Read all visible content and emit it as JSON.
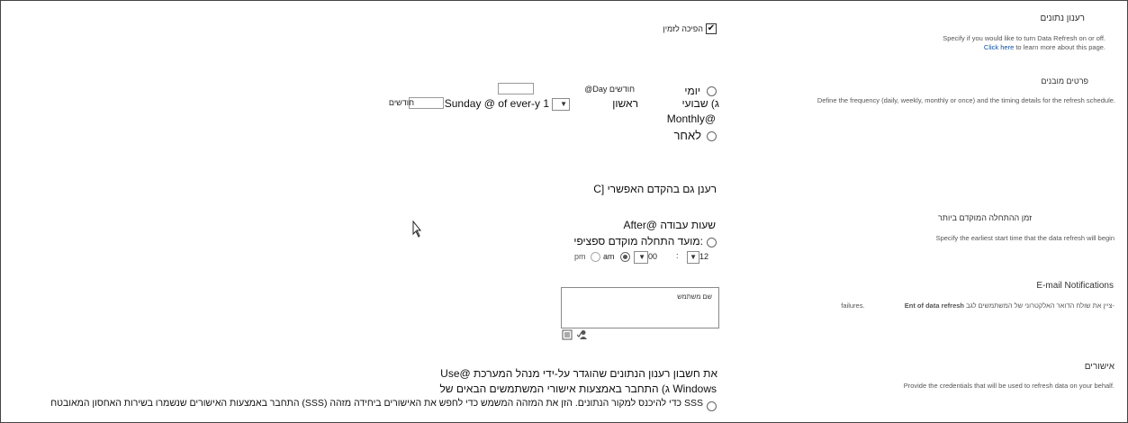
{
  "sections": {
    "refresh": {
      "title": "רענון נתונים",
      "desc_prefix": "Specify if you would like to turn Data Refresh on or off.",
      "link_text": "Click here",
      "desc_suffix": "to learn more about this page.",
      "toggle_label": "הפיכה לזמין",
      "checked": true
    },
    "schedule": {
      "title": "פרטים מובנים",
      "desc": "Define the frequency (daily, weekly, monthly or once) and the timing details for the refresh schedule.",
      "daily_label": "יומי",
      "daily_value": "@Day חודשים",
      "weekly_label": "ג) שבועי",
      "weekly_value": "ראשון",
      "monthly_label": "Monthly@",
      "monthly_value": "Sunday @ of ever-y 1",
      "monthly_suffix": "חודשים",
      "once_label": "לאחר",
      "also_refresh_label": "C] רענן גם בהקדם האפשרי"
    },
    "earliest": {
      "title": "זמן ההתחלה המוקדם ביותר",
      "desc": "Specify the earliest start time that the data refresh will begin",
      "after_label": "After@ שעות עבודה",
      "specific_label": "מועד התחלה מוקדם ספציפי:",
      "hour": "12",
      "separator": ":",
      "minute": "00",
      "am": "am",
      "pm": "pm",
      "am_selected": true
    },
    "email": {
      "title": "E-mail Notifications",
      "desc_prefix": "ציין את שולח הדואר האלקטרוני של המשתמשים לגב-",
      "desc_bold": "Ent of data refresh",
      "desc_suffix": "failures.",
      "field_value": "שם משתמש"
    },
    "credentials": {
      "title": "אישורים",
      "desc": "Provide the credentials that will be used to refresh data on your behalf.",
      "option1": "Use@ את חשבון רענון הנתונים שהוגדר על-ידי מנהל המערכת",
      "option2": "ג) התחבר באמצעות אישורי המשתמשים הבאים של Windows",
      "option3": "התחבר באמצעות האישורים שנשמרו בשירות האחסון המאובטח (SSS) כדי להיכנס למקור הנתונים. הזן את המזהה המשמש כדי לחפש את האישורים ביחידה מזהה SSS"
    }
  },
  "icons": [
    "checkbox-check-icon",
    "radio-icon",
    "chevron-down-icon",
    "address-book-icon",
    "check-names-icon",
    "cursor-icon"
  ]
}
